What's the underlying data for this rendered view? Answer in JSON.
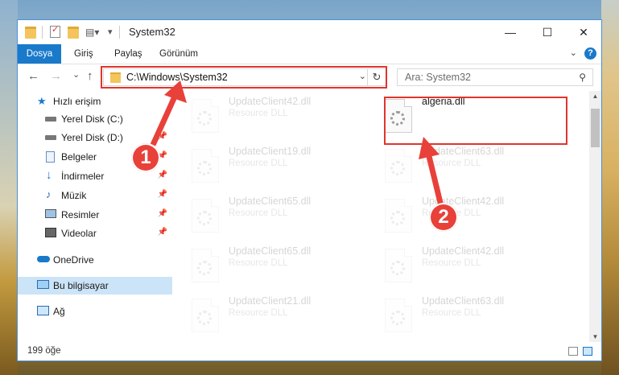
{
  "window": {
    "title": "System32",
    "minimize": "—",
    "maximize": "☐",
    "close": "✕"
  },
  "ribbon": {
    "tabs": [
      "Dosya",
      "Giriş",
      "Paylaş",
      "Görünüm"
    ],
    "help": "?"
  },
  "nav": {
    "back": "←",
    "forward": "→",
    "recent": "⌄",
    "up": "↑",
    "address": "C:\\Windows\\System32",
    "search_placeholder": "Ara: System32"
  },
  "sidebar": {
    "items": [
      {
        "label": "Hızlı erişim",
        "icon": "star-icon"
      },
      {
        "label": "Yerel Disk (C:)",
        "icon": "drive-icon"
      },
      {
        "label": "Yerel Disk (D:)",
        "icon": "drive-icon"
      },
      {
        "label": "Belgeler",
        "icon": "documents-icon"
      },
      {
        "label": "İndirmeler",
        "icon": "download-icon"
      },
      {
        "label": "Müzik",
        "icon": "music-icon"
      },
      {
        "label": "Resimler",
        "icon": "pictures-icon"
      },
      {
        "label": "Videolar",
        "icon": "video-icon"
      },
      {
        "label": "OneDrive",
        "icon": "cloud-icon"
      },
      {
        "label": "Bu bilgisayar",
        "icon": "computer-icon"
      },
      {
        "label": "Ağ",
        "icon": "network-icon"
      }
    ]
  },
  "files": {
    "left": [
      {
        "name": "UpdateClient42.dll",
        "type": "Resource DLL"
      },
      {
        "name": "UpdateClient19.dll",
        "type": "Resource DLL"
      },
      {
        "name": "UpdateClient65.dll",
        "type": "Resource DLL"
      },
      {
        "name": "UpdateClient65.dll",
        "type": "Resource DLL"
      },
      {
        "name": "UpdateClient21.dll",
        "type": "Resource DLL"
      }
    ],
    "right": [
      {
        "name": "algeria.dll",
        "type": ""
      },
      {
        "name": "UpdateClient63.dll",
        "type": "Resource DLL"
      },
      {
        "name": "UpdateClient42.dll",
        "type": "Resource DLL"
      },
      {
        "name": "UpdateClient42.dll",
        "type": "Resource DLL"
      },
      {
        "name": "UpdateClient63.dll",
        "type": "Resource DLL"
      }
    ]
  },
  "status": {
    "count": "199 öğe"
  },
  "annotations": {
    "badge1": "1",
    "badge2": "2"
  }
}
